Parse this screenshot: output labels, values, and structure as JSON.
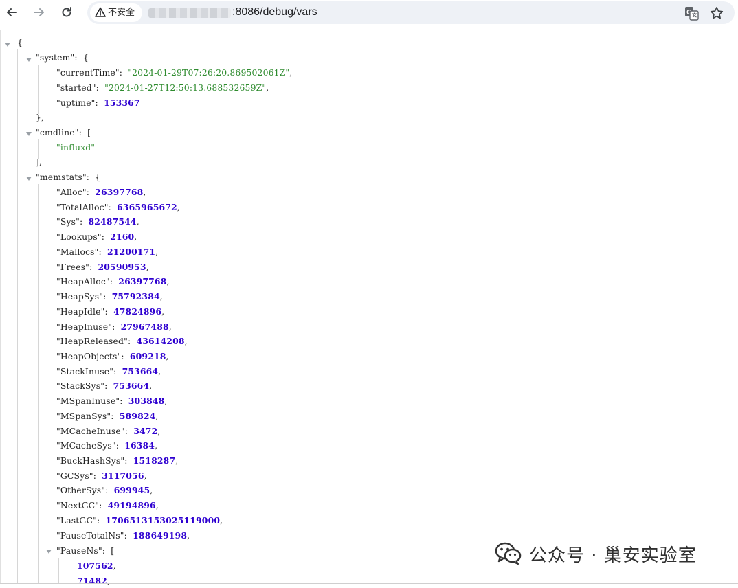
{
  "browser": {
    "security_label": "不安全",
    "url_suffix": ":8086/debug/vars"
  },
  "json": {
    "open_brace": "{",
    "system": {
      "key": "\"system\"",
      "fields": [
        {
          "key": "\"currentTime\"",
          "value": "\"2024-01-29T07:26:20.869502061Z\""
        },
        {
          "key": "\"started\"",
          "value": "\"2024-01-27T12:50:13.688532659Z\""
        },
        {
          "key": "\"uptime\"",
          "value": "153367"
        }
      ]
    },
    "cmdline": {
      "key": "\"cmdline\"",
      "items": [
        "\"influxd\""
      ]
    },
    "memstats": {
      "key": "\"memstats\"",
      "fields": [
        {
          "key": "\"Alloc\"",
          "value": "26397768"
        },
        {
          "key": "\"TotalAlloc\"",
          "value": "6365965672"
        },
        {
          "key": "\"Sys\"",
          "value": "82487544"
        },
        {
          "key": "\"Lookups\"",
          "value": "2160"
        },
        {
          "key": "\"Mallocs\"",
          "value": "21200171"
        },
        {
          "key": "\"Frees\"",
          "value": "20590953"
        },
        {
          "key": "\"HeapAlloc\"",
          "value": "26397768"
        },
        {
          "key": "\"HeapSys\"",
          "value": "75792384"
        },
        {
          "key": "\"HeapIdle\"",
          "value": "47824896"
        },
        {
          "key": "\"HeapInuse\"",
          "value": "27967488"
        },
        {
          "key": "\"HeapReleased\"",
          "value": "43614208"
        },
        {
          "key": "\"HeapObjects\"",
          "value": "609218"
        },
        {
          "key": "\"StackInuse\"",
          "value": "753664"
        },
        {
          "key": "\"StackSys\"",
          "value": "753664"
        },
        {
          "key": "\"MSpanInuse\"",
          "value": "303848"
        },
        {
          "key": "\"MSpanSys\"",
          "value": "589824"
        },
        {
          "key": "\"MCacheInuse\"",
          "value": "3472"
        },
        {
          "key": "\"MCacheSys\"",
          "value": "16384"
        },
        {
          "key": "\"BuckHashSys\"",
          "value": "1518287"
        },
        {
          "key": "\"GCSys\"",
          "value": "3117056"
        },
        {
          "key": "\"OtherSys\"",
          "value": "699945"
        },
        {
          "key": "\"NextGC\"",
          "value": "49194896"
        },
        {
          "key": "\"LastGC\"",
          "value": "1706513153025119000"
        },
        {
          "key": "\"PauseTotalNs\"",
          "value": "188649198"
        }
      ],
      "pause_ns": {
        "key": "\"PauseNs\"",
        "items": [
          "107562",
          "71482"
        ]
      }
    }
  },
  "watermark": {
    "text": "公众号 · 巢安实验室"
  }
}
